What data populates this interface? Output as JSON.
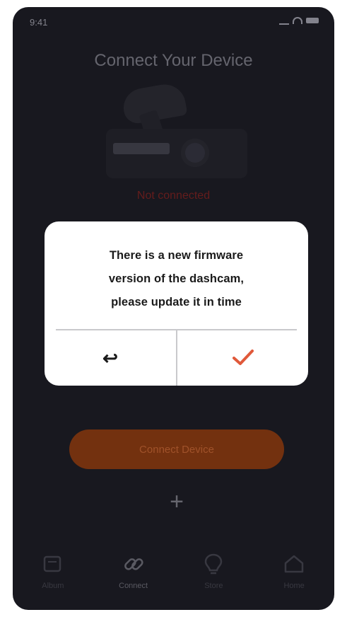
{
  "status_bar": {
    "time": "9:41"
  },
  "page": {
    "title": "Connect Your Device"
  },
  "red_link": {
    "text": "Not connected"
  },
  "dialog": {
    "message_line1": "There is a new firmware",
    "message_line2": "version of the dashcam,",
    "message_line3": "please update it in time",
    "back_glyph": "↩",
    "confirm_icon": "check-icon",
    "accent_color": "#e0593a"
  },
  "actions": {
    "connect_label": "Connect Device",
    "add_glyph": "+"
  },
  "bottom_nav": [
    {
      "label": "Album",
      "icon": "album-icon"
    },
    {
      "label": "Connect",
      "icon": "link-icon"
    },
    {
      "label": "Store",
      "icon": "bulb-icon"
    },
    {
      "label": "Home",
      "icon": "home-icon"
    }
  ],
  "colors": {
    "screen_bg": "#1a1a21",
    "dialog_bg": "#ffffff",
    "orange_dim": "#7a3410"
  }
}
